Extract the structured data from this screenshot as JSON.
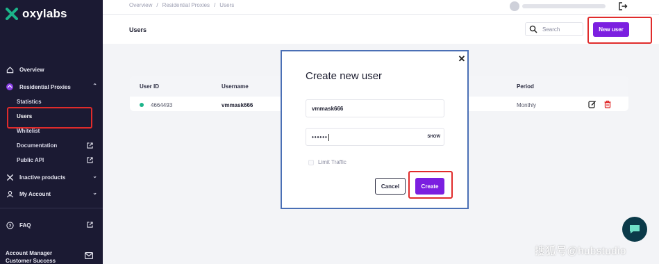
{
  "brand": {
    "name": "oxylabs",
    "accent": "#7b1fe0",
    "sidebar_bg": "#1b1a33",
    "logo_color": "#1cb48a"
  },
  "sidebar": {
    "items": [
      {
        "label": "Overview",
        "icon": "home-icon"
      },
      {
        "label": "Residential Proxies",
        "icon": "residential-icon"
      },
      {
        "label": "Statistics"
      },
      {
        "label": "Users"
      },
      {
        "label": "Whitelist"
      },
      {
        "label": "Documentation",
        "icon": "external-link-icon"
      },
      {
        "label": "Public API",
        "icon": "external-link-icon"
      },
      {
        "label": "Inactive products",
        "icon": "inactive-products-icon"
      },
      {
        "label": "My Account",
        "icon": "user-icon"
      },
      {
        "label": "FAQ",
        "icon": "help-icon"
      }
    ],
    "footer": {
      "line1": "Account Manager",
      "line2": "Customer Success",
      "icon": "mail-icon"
    }
  },
  "topbar": {
    "breadcrumb": [
      "Overview",
      "Residential Proxies",
      "Users"
    ],
    "logout_icon": "logout-icon"
  },
  "header": {
    "title": "Users",
    "search_placeholder": "Search",
    "new_user_label": "New user"
  },
  "table": {
    "columns": [
      "User ID",
      "Username",
      "Period"
    ],
    "rows": [
      {
        "id": "4664493",
        "username": "vmmask666",
        "period": "Monthly",
        "status": "active"
      }
    ]
  },
  "modal": {
    "title": "Create new user",
    "username_value": "vmmask666",
    "password_value": "••••••",
    "show_label": "SHOW",
    "limit_label": "Limit Traffic",
    "cancel_label": "Cancel",
    "create_label": "Create"
  },
  "watermark": "搜狐号@hubstudio"
}
